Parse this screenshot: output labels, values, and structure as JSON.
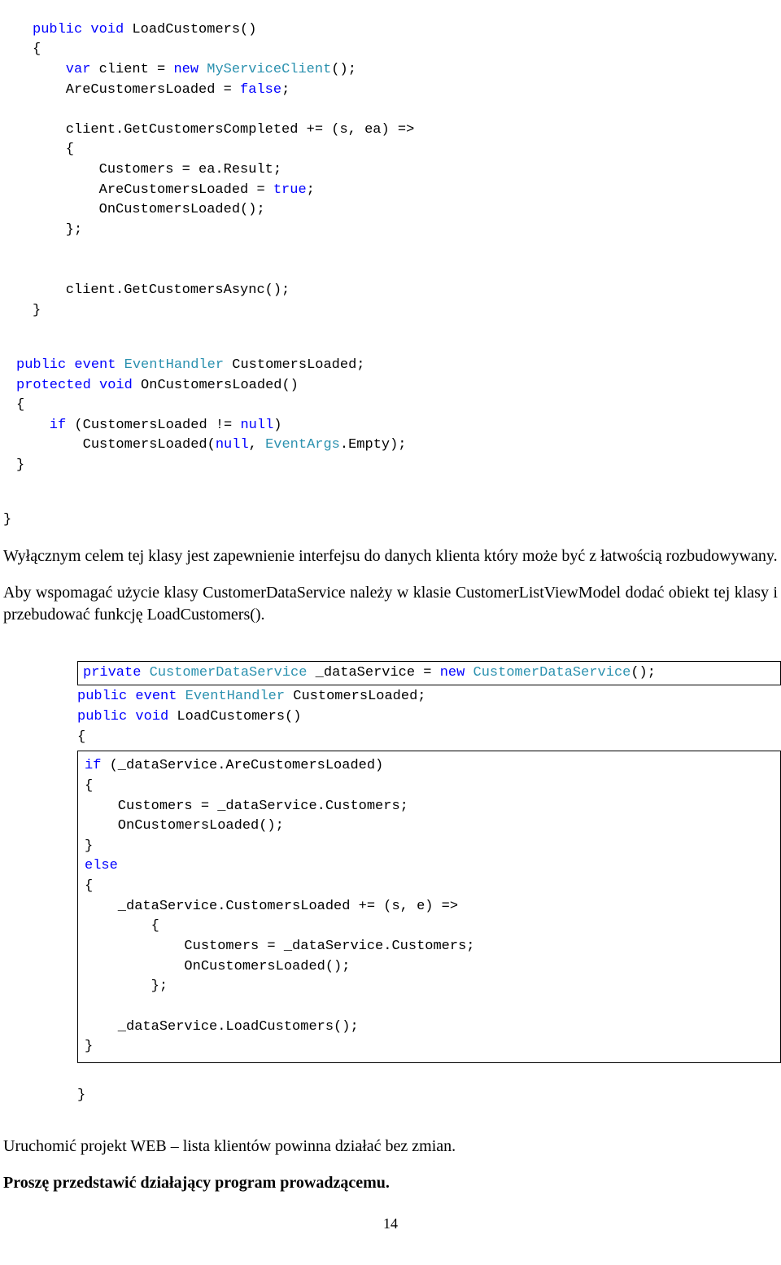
{
  "code1": {
    "l1a": "public",
    "l1b": "void",
    "l1c": " LoadCustomers()",
    "l2": "{",
    "l3a": "    var",
    "l3b": " client = ",
    "l3c": "new",
    "l3d": " MyServiceClient",
    "l3e": "();",
    "l4a": "    AreCustomersLoaded = ",
    "l4b": "false",
    "l4c": ";",
    "blank1": "",
    "l5": "    client.GetCustomersCompleted += (s, ea) =>",
    "l6": "    {",
    "l7": "        Customers = ea.Result;",
    "l8a": "        AreCustomersLoaded = ",
    "l8b": "true",
    "l8c": ";",
    "l9": "        OnCustomersLoaded();",
    "l10": "    };",
    "blank2": "",
    "blank3": "",
    "l11": "    client.GetCustomersAsync();",
    "l12": "}"
  },
  "code2": {
    "l1a": "public",
    "l1b": " event",
    "l1c": " EventHandler",
    "l1d": " CustomersLoaded;",
    "l2a": "protected",
    "l2b": " void",
    "l2c": " OnCustomersLoaded()",
    "l3": "{",
    "l4a": "    if",
    "l4b": " (CustomersLoaded != ",
    "l4c": "null",
    "l4d": ")",
    "l5a": "        CustomersLoaded(",
    "l5b": "null",
    "l5c": ", ",
    "l5d": "EventArgs",
    "l5e": ".Empty);",
    "l6": "}",
    "l7": "}"
  },
  "para1": "Wyłącznym celem tej klasy jest zapewnienie interfejsu do danych klienta który może być z łatwością rozbudowywany.",
  "para2": "Aby wspomagać użycie klasy CustomerDataService należy w klasie CustomerListViewModel dodać obiekt tej klasy i przebudować funkcję LoadCustomers().",
  "code3": {
    "box1a": "private",
    "box1b": " CustomerDataService",
    "box1c": " _dataService = ",
    "box1d": "new",
    "box1e": " CustomerDataService",
    "box1f": "();",
    "l2a": "public",
    "l2b": " event",
    "l2c": " EventHandler",
    "l2d": " CustomersLoaded;",
    "l3a": "public",
    "l3b": " void",
    "l3c": " LoadCustomers()",
    "l4": "{",
    "b1a": "if",
    "b1b": " (_dataService.AreCustomersLoaded)",
    "b2": "{",
    "b3": "    Customers = _dataService.Customers;",
    "b4": "    OnCustomersLoaded();",
    "b5": "}",
    "b6": "else",
    "b7": "{",
    "b8": "    _dataService.CustomersLoaded += (s, e) =>",
    "b9": "        {",
    "b10": "            Customers = _dataService.Customers;",
    "b11": "            OnCustomersLoaded();",
    "b12": "        };",
    "blank": "",
    "b13": "    _dataService.LoadCustomers();",
    "b14": "}",
    "lend": "}"
  },
  "para3": "Uruchomić projekt WEB – lista klientów powinna działać bez zmian.",
  "para4": "Proszę przedstawić działający program prowadzącemu.",
  "page_number": "14"
}
